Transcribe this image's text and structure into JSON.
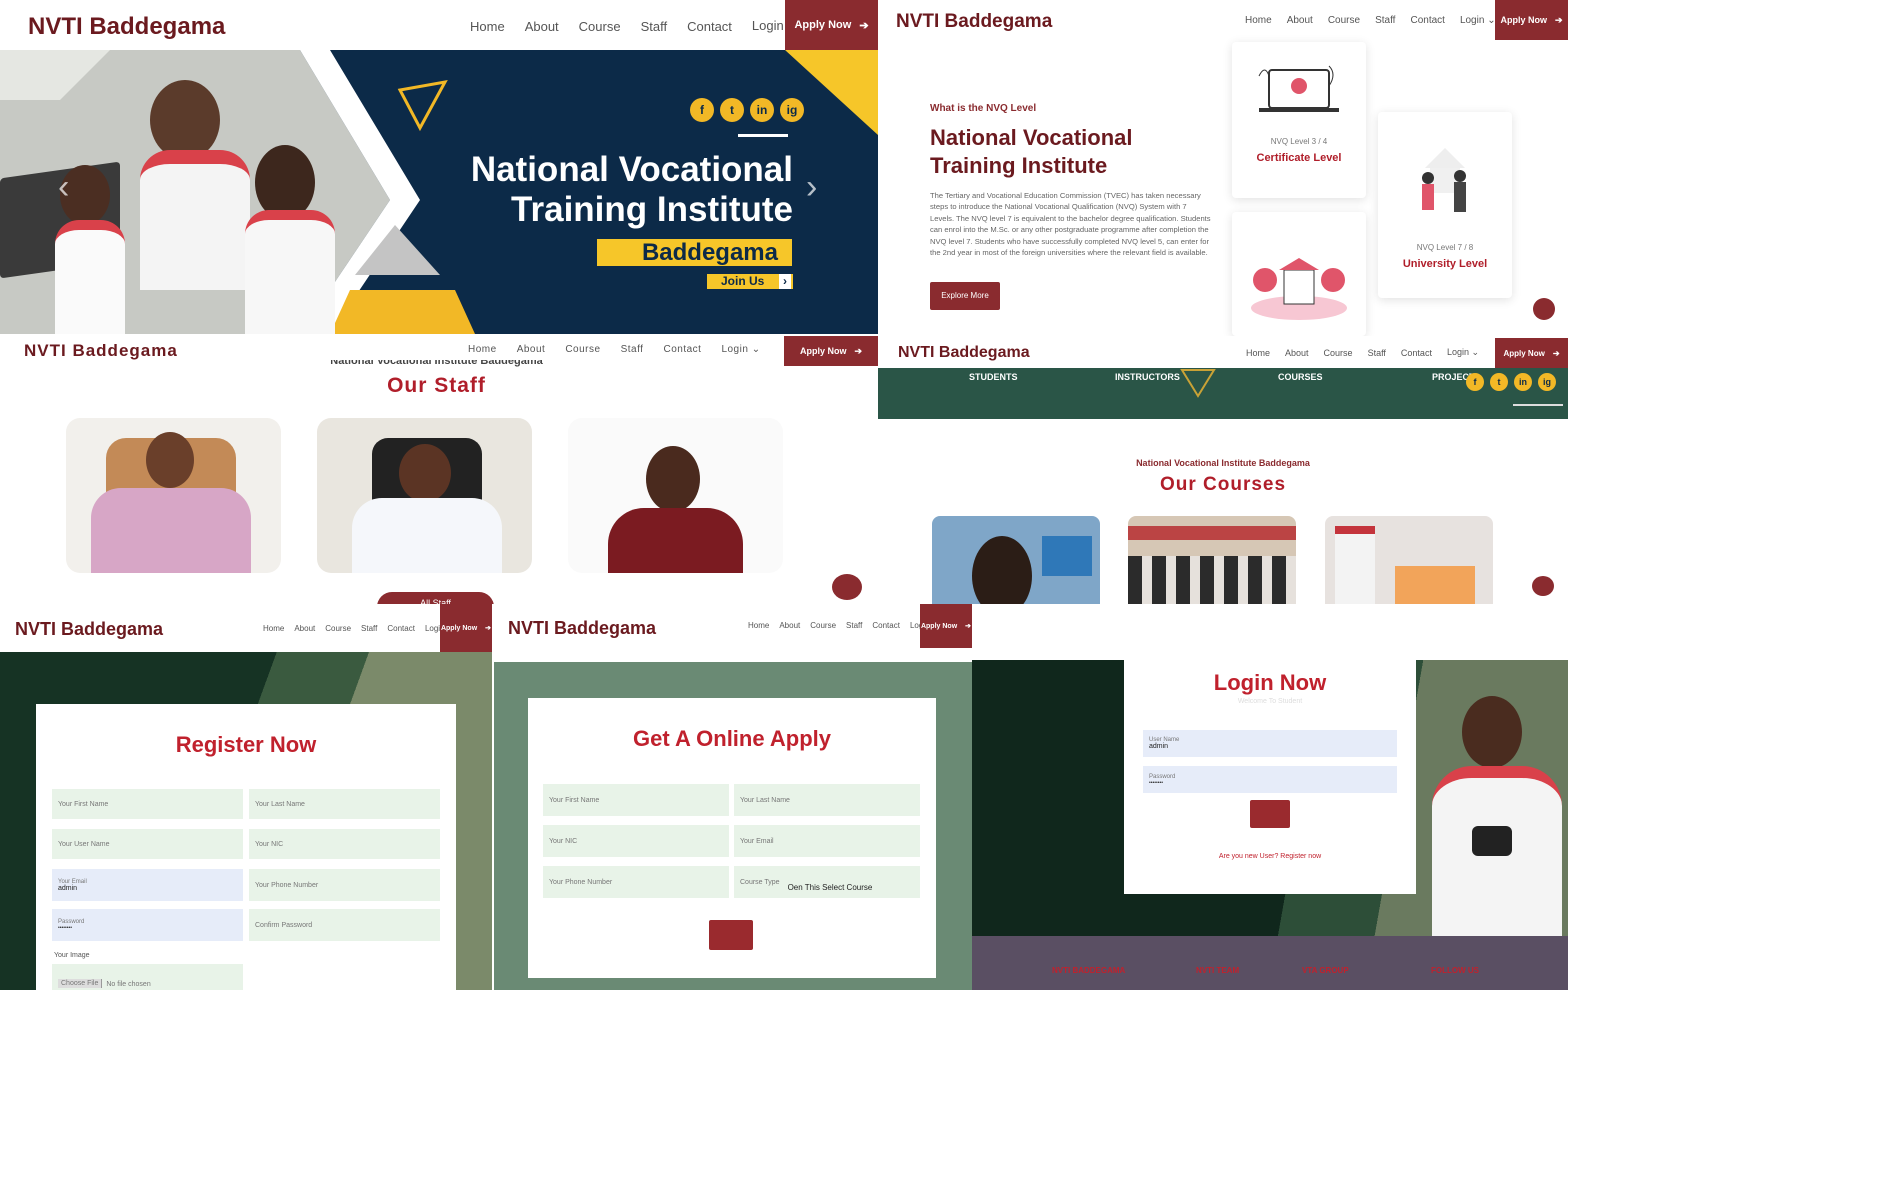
{
  "site": {
    "logo": "NVTI Baddegama",
    "nav": [
      "Home",
      "About",
      "Course",
      "Staff",
      "Contact",
      "Login"
    ],
    "login_caret": "⌄",
    "apply_label": "Apply Now",
    "apply_arrow": "➔"
  },
  "hero": {
    "title_line1": "National Vocational",
    "title_line2": "Training Institute",
    "location": "Baddegama",
    "cta": "Join Us",
    "cta_arrow": "›",
    "social": [
      "f",
      "t",
      "in",
      "ig"
    ],
    "prev_arrow": "‹",
    "next_arrow": "›"
  },
  "nvq": {
    "eyebrow": "What is the NVQ Level",
    "title_line1": "National Vocational",
    "title_line2": "Training Institute",
    "body": "The Tertiary and Vocational Education Commission (TVEC) has taken necessary steps to introduce the National Vocational Qualification (NVQ) System with 7 Levels. The NVQ level 7 is equivalent to the bachelor degree qualification. Students can enrol into the M.Sc. or any other postgraduate programme after completion the NVQ level 7. Students who have successfully completed NVQ level 5, can enter for the 2nd year in most of the foreign universities where the relevant field is available.",
    "button": "Explore More",
    "card1_small": "NVQ Level 3 / 4",
    "card1_title": "Certificate Level",
    "card2_small": "NVQ Level 7 / 8",
    "card2_title": "University Level"
  },
  "staff": {
    "subtitle": "National Vocational Institute Baddegama",
    "title": "Our Staff",
    "button": "All Staff"
  },
  "courses": {
    "stats": [
      "STUDENTS",
      "INSTRUCTORS",
      "COURSES",
      "PROJECT"
    ],
    "subtitle": "National Vocational Institute Baddegama",
    "title": "Our Courses"
  },
  "register": {
    "title": "Register Now",
    "first_name": "Your First Name",
    "last_name": "Your Last Name",
    "user_name": "Your User Name",
    "nic": "Your NIC",
    "email_label": "Your Email",
    "email_value": "admin",
    "phone": "Your Phone Number",
    "password_label": "Password",
    "password_value": "••••••••",
    "confirm": "Confirm Password",
    "image_label": "Your Image",
    "choose_file": "Choose File",
    "no_file": "No file chosen"
  },
  "apply_form": {
    "title": "Get A Online Apply",
    "first_name": "Your First Name",
    "last_name": "Your Last Name",
    "nic": "Your NIC",
    "email": "Your Email",
    "phone": "Your Phone Number",
    "course_type": "Course Type",
    "course_select": "Oen This Select Course"
  },
  "login": {
    "title": "Login Now",
    "subtitle": "Welcome To Student",
    "user_label": "User Name",
    "user_value": "admin",
    "pass_label": "Password",
    "pass_value": "••••••••",
    "register_link": "Are you new User? Register now"
  },
  "footer": {
    "cols": [
      "NVTI BADDEGAMA",
      "NVTI TEAM",
      "VTA GROUP",
      "FOLLOW US"
    ]
  },
  "colors": {
    "brand": "#8a2b2f",
    "navy": "#0c2a48",
    "yellow": "#f2b826",
    "green_dark": "#1f3a2c",
    "sage": "#6a8a74"
  }
}
